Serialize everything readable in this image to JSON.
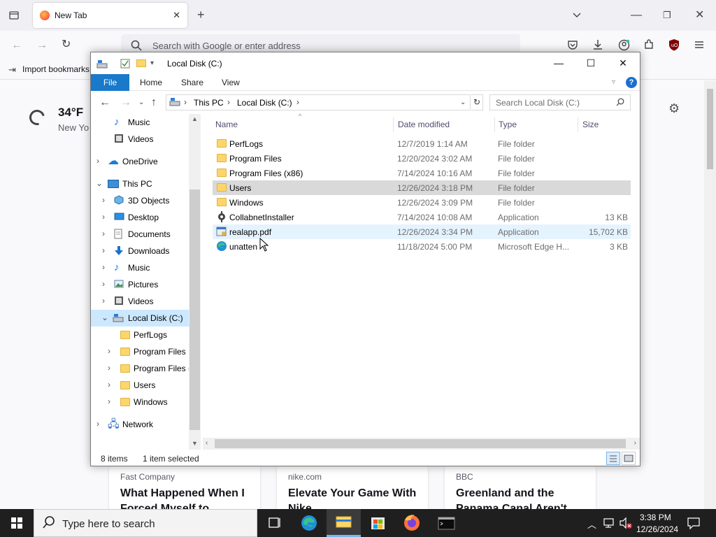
{
  "browser": {
    "tab_title": "New Tab",
    "url_placeholder": "Search with Google or enter address",
    "bookmark_import": "Import bookmarks",
    "weather": {
      "temp": "34°F",
      "location": "New Yo"
    },
    "news": [
      {
        "source": "Fast Company",
        "headline": "What Happened When I Forced Myself to"
      },
      {
        "source": "nike.com",
        "headline": "Elevate Your Game With Nike"
      },
      {
        "source": "BBC",
        "headline": "Greenland and the Panama Canal Aren't"
      }
    ]
  },
  "explorer": {
    "title": "Local Disk (C:)",
    "ribbon_tabs": [
      "File",
      "Home",
      "Share",
      "View"
    ],
    "breadcrumb": [
      "This PC",
      "Local Disk (C:)"
    ],
    "search_placeholder": "Search Local Disk (C:)",
    "nav": [
      {
        "label": "Music",
        "icon": "music-icon"
      },
      {
        "label": "Videos",
        "icon": "video-icon"
      },
      {
        "label": "OneDrive",
        "icon": "cloud-icon"
      },
      {
        "label": "This PC",
        "icon": "computer-icon"
      },
      {
        "label": "3D Objects",
        "icon": "cube-icon"
      },
      {
        "label": "Desktop",
        "icon": "desktop-icon"
      },
      {
        "label": "Documents",
        "icon": "document-icon"
      },
      {
        "label": "Downloads",
        "icon": "download-icon"
      },
      {
        "label": "Music",
        "icon": "music-icon"
      },
      {
        "label": "Pictures",
        "icon": "pictures-icon"
      },
      {
        "label": "Videos",
        "icon": "video-icon"
      },
      {
        "label": "Local Disk (C:)",
        "icon": "drive-icon"
      },
      {
        "label": "PerfLogs",
        "icon": "folder-icon"
      },
      {
        "label": "Program Files",
        "icon": "folder-icon"
      },
      {
        "label": "Program Files (",
        "icon": "folder-icon"
      },
      {
        "label": "Users",
        "icon": "folder-icon"
      },
      {
        "label": "Windows",
        "icon": "folder-icon"
      },
      {
        "label": "Network",
        "icon": "network-icon"
      }
    ],
    "columns": {
      "name": "Name",
      "date": "Date modified",
      "type": "Type",
      "size": "Size"
    },
    "files": [
      {
        "name": "PerfLogs",
        "date": "12/7/2019 1:14 AM",
        "type": "File folder",
        "size": "",
        "icon": "folder-icon"
      },
      {
        "name": "Program Files",
        "date": "12/20/2024 3:02 AM",
        "type": "File folder",
        "size": "",
        "icon": "folder-icon"
      },
      {
        "name": "Program Files (x86)",
        "date": "7/14/2024 10:16 AM",
        "type": "File folder",
        "size": "",
        "icon": "folder-icon"
      },
      {
        "name": "Users",
        "date": "12/26/2024 3:18 PM",
        "type": "File folder",
        "size": "",
        "icon": "folder-icon"
      },
      {
        "name": "Windows",
        "date": "12/26/2024 3:09 PM",
        "type": "File folder",
        "size": "",
        "icon": "folder-icon"
      },
      {
        "name": "CollabnetInstaller",
        "date": "7/14/2024 10:08 AM",
        "type": "Application",
        "size": "13 KB",
        "icon": "installer-icon"
      },
      {
        "name": "realapp.pdf",
        "date": "12/26/2024 3:34 PM",
        "type": "Application",
        "size": "15,702 KB",
        "icon": "app-icon"
      },
      {
        "name": "unatten",
        "date": "11/18/2024 5:00 PM",
        "type": "Microsoft Edge H...",
        "size": "3 KB",
        "icon": "edge-icon"
      }
    ],
    "status": {
      "count": "8 items",
      "selected": "1 item selected"
    }
  },
  "taskbar": {
    "search_placeholder": "Type here to search",
    "time": "3:38 PM",
    "date": "12/26/2024"
  }
}
